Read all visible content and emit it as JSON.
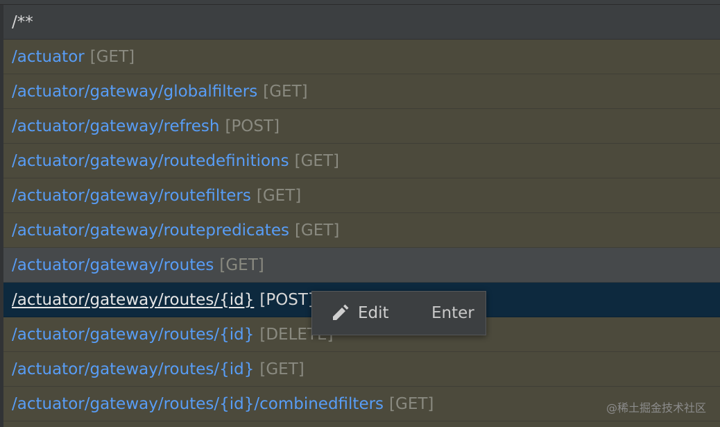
{
  "endpoints": [
    {
      "path": "/**",
      "method": ""
    },
    {
      "path": "/actuator",
      "method": "[GET]"
    },
    {
      "path": "/actuator/gateway/globalfilters",
      "method": "[GET]"
    },
    {
      "path": "/actuator/gateway/refresh",
      "method": "[POST]"
    },
    {
      "path": "/actuator/gateway/routedefinitions",
      "method": "[GET]"
    },
    {
      "path": "/actuator/gateway/routefilters",
      "method": "[GET]"
    },
    {
      "path": "/actuator/gateway/routepredicates",
      "method": "[GET]"
    },
    {
      "path": "/actuator/gateway/routes",
      "method": "[GET]"
    },
    {
      "path": "/actuator/gateway/routes/{id}",
      "method": "[POST]"
    },
    {
      "path": "/actuator/gateway/routes/{id}",
      "method": "[DELETE]"
    },
    {
      "path": "/actuator/gateway/routes/{id}",
      "method": "[GET]"
    },
    {
      "path": "/actuator/gateway/routes/{id}/combinedfilters",
      "method": "[GET]"
    }
  ],
  "popup": {
    "icon": "pencil-icon",
    "label": "Edit",
    "shortcut": "Enter"
  },
  "watermark": "@稀土掘金技术社区",
  "colors": {
    "path": "#589df6",
    "method": "#8a8a80",
    "row_background": "#4c4a3c",
    "selected_background": "#0d293e"
  }
}
